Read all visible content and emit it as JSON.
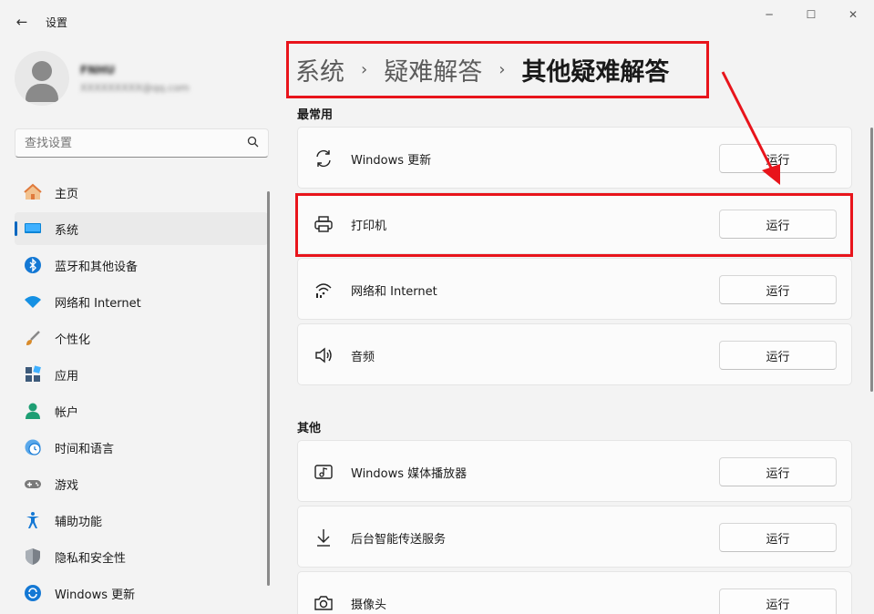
{
  "window": {
    "title": "设置",
    "back_icon": "back-arrow-icon",
    "controls": {
      "minimize": "─",
      "maximize": "☐",
      "close": "✕"
    }
  },
  "profile": {
    "name": "FNHU",
    "email": "XXXXXXXXX@qq.com"
  },
  "search": {
    "value": "查找设置",
    "icon": "search-icon"
  },
  "sidebar": {
    "items": [
      {
        "label": "主页",
        "icon": "home-icon",
        "color": "#e07a3c"
      },
      {
        "label": "系统",
        "icon": "display-icon",
        "color": "#0a84d6"
      },
      {
        "label": "蓝牙和其他设备",
        "icon": "bluetooth-icon",
        "color": "#1478d4"
      },
      {
        "label": "网络和 Internet",
        "icon": "wifi-icon",
        "color": "#1590e3"
      },
      {
        "label": "个性化",
        "icon": "brush-icon",
        "color": "#d88a2a"
      },
      {
        "label": "应用",
        "icon": "apps-icon",
        "color": "#3d5a7a"
      },
      {
        "label": "帐户",
        "icon": "account-icon",
        "color": "#1e9e73"
      },
      {
        "label": "时间和语言",
        "icon": "clock-globe-icon",
        "color": "#1478d4"
      },
      {
        "label": "游戏",
        "icon": "gamepad-icon",
        "color": "#7a7a7a"
      },
      {
        "label": "辅助功能",
        "icon": "accessibility-icon",
        "color": "#1478d4"
      },
      {
        "label": "隐私和安全性",
        "icon": "shield-icon",
        "color": "#7a8088"
      },
      {
        "label": "Windows 更新",
        "icon": "update-icon",
        "color": "#1478d4"
      }
    ],
    "active_index": 1
  },
  "breadcrumb": {
    "items": [
      "系统",
      "疑难解答",
      "其他疑难解答"
    ],
    "separator": "›"
  },
  "sections": [
    {
      "title": "最常用",
      "items": [
        {
          "label": "Windows 更新",
          "icon": "refresh-icon",
          "button": "运行"
        },
        {
          "label": "打印机",
          "icon": "printer-icon",
          "button": "运行"
        },
        {
          "label": "网络和 Internet",
          "icon": "network-icon",
          "button": "运行"
        },
        {
          "label": "音频",
          "icon": "speaker-icon",
          "button": "运行"
        }
      ]
    },
    {
      "title": "其他",
      "items": [
        {
          "label": "Windows 媒体播放器",
          "icon": "media-player-icon",
          "button": "运行"
        },
        {
          "label": "后台智能传送服务",
          "icon": "download-icon",
          "button": "运行"
        },
        {
          "label": "摄像头",
          "icon": "camera-icon",
          "button": "运行"
        }
      ]
    }
  ],
  "annotations": {
    "highlight_color": "#e8141b"
  }
}
